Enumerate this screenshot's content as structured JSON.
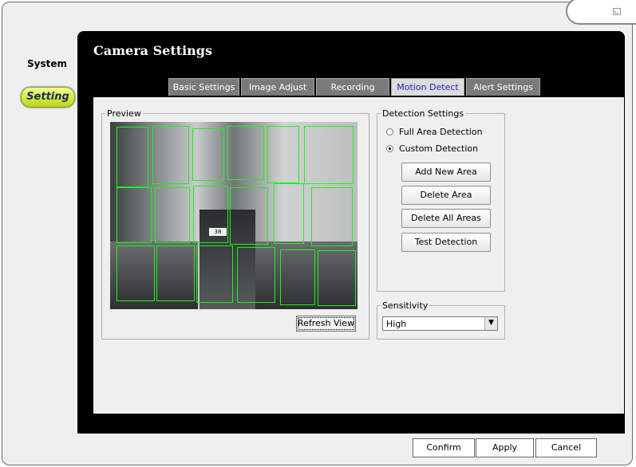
{
  "sidebar": {
    "system_label": "System",
    "setting_label": "Setting"
  },
  "page": {
    "title": "Camera Settings"
  },
  "tabs": [
    {
      "label": "Basic Settings"
    },
    {
      "label": "Image Adjust"
    },
    {
      "label": "Recording"
    },
    {
      "label": "Motion Detect",
      "active": true
    },
    {
      "label": "Alert Settings"
    }
  ],
  "preview": {
    "legend": "Preview",
    "refresh_label": "Refresh View",
    "sign_text": "38"
  },
  "detection": {
    "legend": "Detection Settings",
    "full_area_label": "Full Area Detection",
    "custom_label": "Custom Detection",
    "selected": "custom",
    "add_area_label": "Add New Area",
    "delete_area_label": "Delete Area",
    "delete_all_label": "Delete All Areas",
    "test_label": "Test Detection"
  },
  "sensitivity": {
    "legend": "Sensitivity",
    "value": "High"
  },
  "footer": {
    "confirm_label": "Confirm",
    "apply_label": "Apply",
    "cancel_label": "Cancel"
  },
  "colors": {
    "active_tab_text": "#2222cc",
    "detection_area_border": "#22ee22",
    "panel_background": "#000000",
    "setting_badge": "#d6ec3a"
  }
}
